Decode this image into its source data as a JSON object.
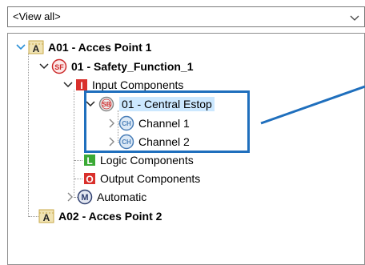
{
  "dropdown": {
    "value": "<View all>"
  },
  "tree": {
    "a01": {
      "badge": "A",
      "label": "A01 - Acces Point 1"
    },
    "sf01": {
      "badge": "SF",
      "label": "01 - Safety_Function_1"
    },
    "input": {
      "badge": "I",
      "label": "Input Components"
    },
    "sb01": {
      "badge": "SB",
      "label": "01 - Central Estop"
    },
    "ch1": {
      "badge": "CH",
      "label": "Channel 1"
    },
    "ch2": {
      "badge": "CH",
      "label": "Channel 2"
    },
    "logic": {
      "badge": "L",
      "label": "Logic Components"
    },
    "output": {
      "badge": "O",
      "label": "Output Components"
    },
    "automatic": {
      "badge": "M",
      "label": "Automatic"
    },
    "a02": {
      "badge": "A",
      "label": "A02 - Acces Point 2"
    }
  },
  "colors": {
    "accent": "#1f6fbd",
    "selection": "#cce8ff",
    "expander": "#2a8fd6",
    "input_icon": "#d9302c",
    "logic_icon": "#3aa935",
    "output_icon": "#d9302c",
    "sf_icon": "#cc2a2a",
    "sb_icon": "#8a8a8a",
    "ch_icon": "#4b7fb8",
    "m_icon": "#2f3f6f",
    "a_icon": "#c9a94a"
  }
}
